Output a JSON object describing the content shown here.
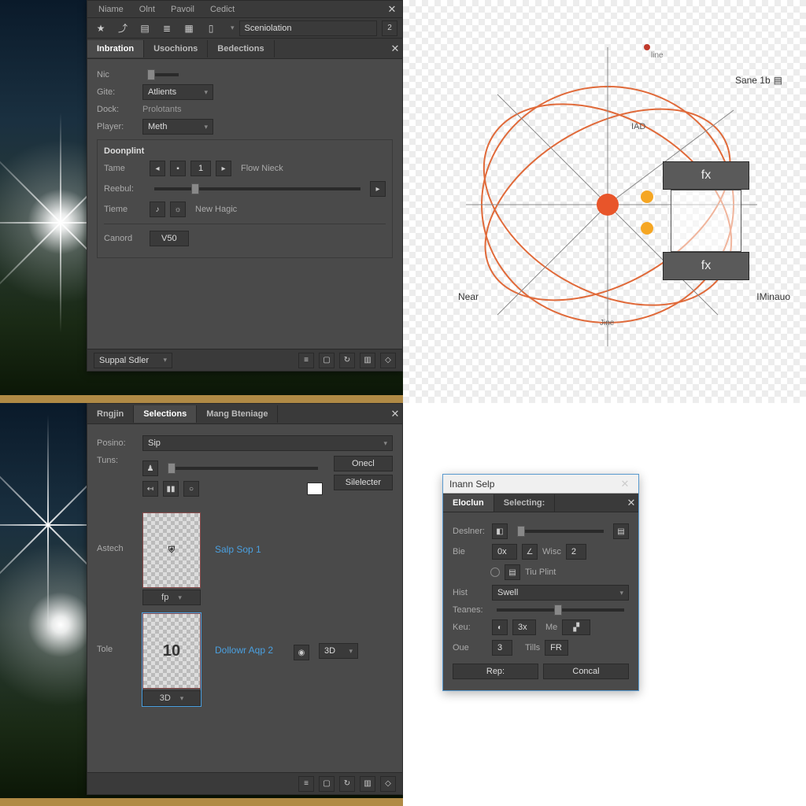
{
  "q1": {
    "menu": [
      "Niame",
      "Olnt",
      "Pavoil",
      "Cedict"
    ],
    "scene_input": "Sceniolation",
    "scene_count": "2",
    "tabs": [
      "Inbration",
      "Usochions",
      "Bedections"
    ],
    "nic_label": "Nic",
    "fields": {
      "gite_label": "Gite:",
      "gite_value": "Atlients",
      "dock_label": "Dock:",
      "dock_value": "Prolotants",
      "player_label": "Player:",
      "player_value": "Meth"
    },
    "group": {
      "title": "Doonplint",
      "tame_label": "Tame",
      "tame_value": "1",
      "tame_suffix": "Flow Nieck",
      "reebul_label": "Reebul:",
      "tieme_label": "Tieme",
      "tieme_suffix": "New Hagic",
      "cancel_label": "Canord",
      "value_btn": "V50"
    },
    "footer_dropdown": "Suppal Sdler",
    "footer_icons": [
      "menu",
      "stop",
      "refresh",
      "grid",
      "drop"
    ]
  },
  "q2": {
    "labels": {
      "top_right": "Sane 1b",
      "upper_mid": "IAD",
      "center_small": "line",
      "left": "Near",
      "bottom": "Jine",
      "right": "IMinauo"
    },
    "box_icon": "fx"
  },
  "q3": {
    "tabs": [
      "Rngjin",
      "Selections",
      "Mang Bteniage"
    ],
    "posino_label": "Posino:",
    "posino_value": "Sip",
    "tuns_label": "Tuns:",
    "btn_oned": "Onecl",
    "btn_silecter": "Silelecter",
    "astech_label": "Astech",
    "tole_label": "Tole",
    "card1_label": "Salp Sop 1",
    "card1_btn": "fp",
    "card2_value": "10",
    "card2_label": "Dollowr Aqp 2",
    "card2_btn": "3D",
    "footer_icons": [
      "menu",
      "stop",
      "refresh",
      "grid",
      "drop"
    ]
  },
  "q4": {
    "title": "Inann Selp",
    "tabs": [
      "Eloclun",
      "Selecting:"
    ],
    "deslner_label": "Deslner:",
    "bie_label": "Bie",
    "bie_value": "0x",
    "wisc_label": "Wisc",
    "wisc_value": "2",
    "tiuplint_label": "Tiu Plint",
    "hist_label": "Hist",
    "hist_value": "Swell",
    "teanes_label": "Teanes:",
    "keu_label": "Keu:",
    "keu_value": "3x",
    "me_label": "Me",
    "oue_label": "Oue",
    "oue_value": "3",
    "tills_label": "Tills",
    "tills_value": "FR",
    "rep_btn": "Rep:",
    "cancel_btn": "Concal"
  }
}
